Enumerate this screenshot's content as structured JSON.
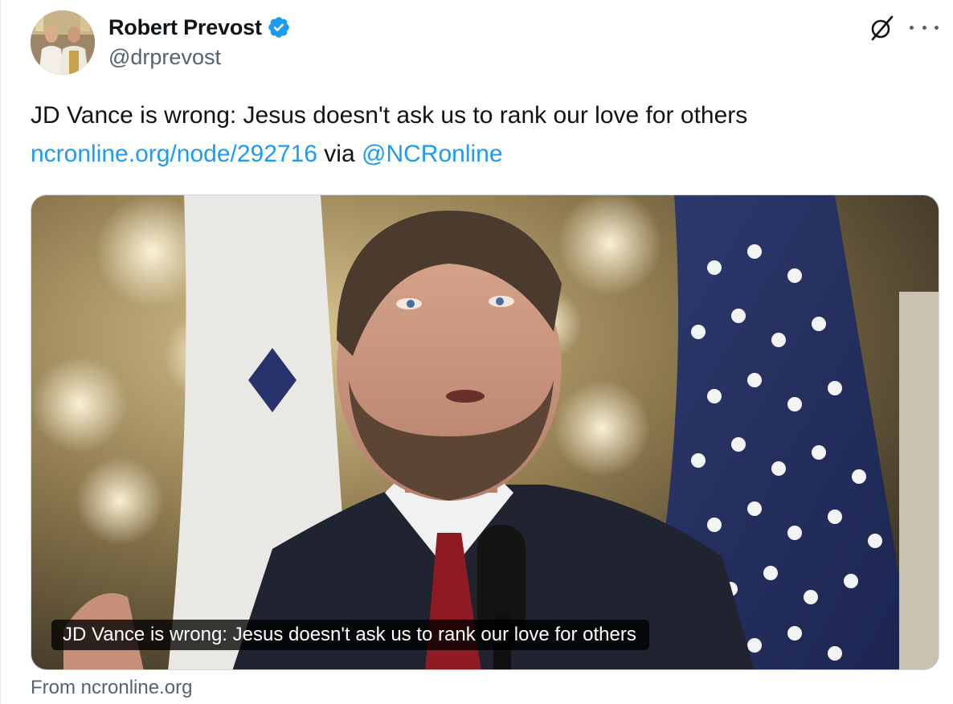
{
  "author": {
    "display_name": "Robert Prevost",
    "handle": "@drprevost",
    "verified": true,
    "verified_color": "#1d9bf0"
  },
  "header_icons": {
    "grok": "grok-slash-circle-icon",
    "more": "more-horizontal-icon"
  },
  "tweet": {
    "text_main": "JD Vance is wrong: Jesus doesn't ask us to rank our love for others",
    "link_url": "ncronline.org/node/292716",
    "via_word": "via",
    "mention": "@NCRonline",
    "link_color": "#1d9bf0"
  },
  "card": {
    "caption": "JD Vance is wrong: Jesus doesn't ask us to rank our love for others",
    "source": "From ncronline.org"
  }
}
